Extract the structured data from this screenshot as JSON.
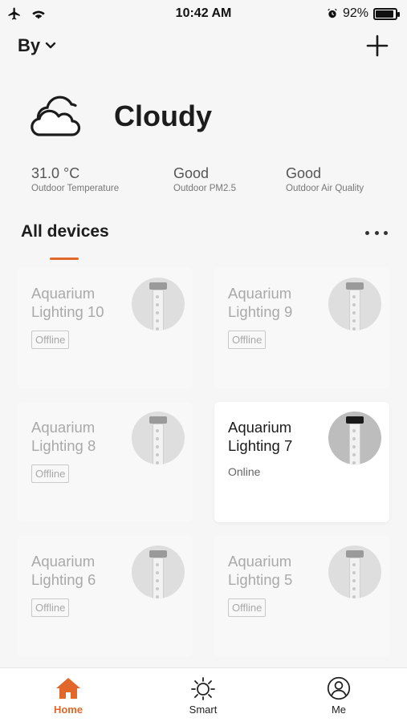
{
  "status_bar": {
    "time": "10:42 AM",
    "battery_text": "92%",
    "battery_level": 0.92
  },
  "header": {
    "home_name": "By"
  },
  "weather": {
    "condition": "Cloudy",
    "stats": [
      {
        "value": "31.0 °C",
        "label": "Outdoor Temperature"
      },
      {
        "value": "Good",
        "label": "Outdoor PM2.5"
      },
      {
        "value": "Good",
        "label": "Outdoor Air Quality"
      }
    ]
  },
  "devices_section": {
    "title": "All devices"
  },
  "devices": [
    {
      "name": "Aquarium Lighting 10",
      "status": "Offline",
      "online": false
    },
    {
      "name": "Aquarium Lighting 9",
      "status": "Offline",
      "online": false
    },
    {
      "name": "Aquarium Lighting 8",
      "status": "Offline",
      "online": false
    },
    {
      "name": "Aquarium Lighting 7",
      "status": "Online",
      "online": true
    },
    {
      "name": "Aquarium Lighting 6",
      "status": "Offline",
      "online": false
    },
    {
      "name": "Aquarium Lighting 5",
      "status": "Offline",
      "online": false
    }
  ],
  "tab_bar": {
    "tabs": [
      {
        "label": "Home",
        "icon": "home-icon",
        "active": true
      },
      {
        "label": "Smart",
        "icon": "sun-icon",
        "active": false
      },
      {
        "label": "Me",
        "icon": "profile-icon",
        "active": false
      }
    ]
  },
  "colors": {
    "accent": "#e1672a"
  }
}
